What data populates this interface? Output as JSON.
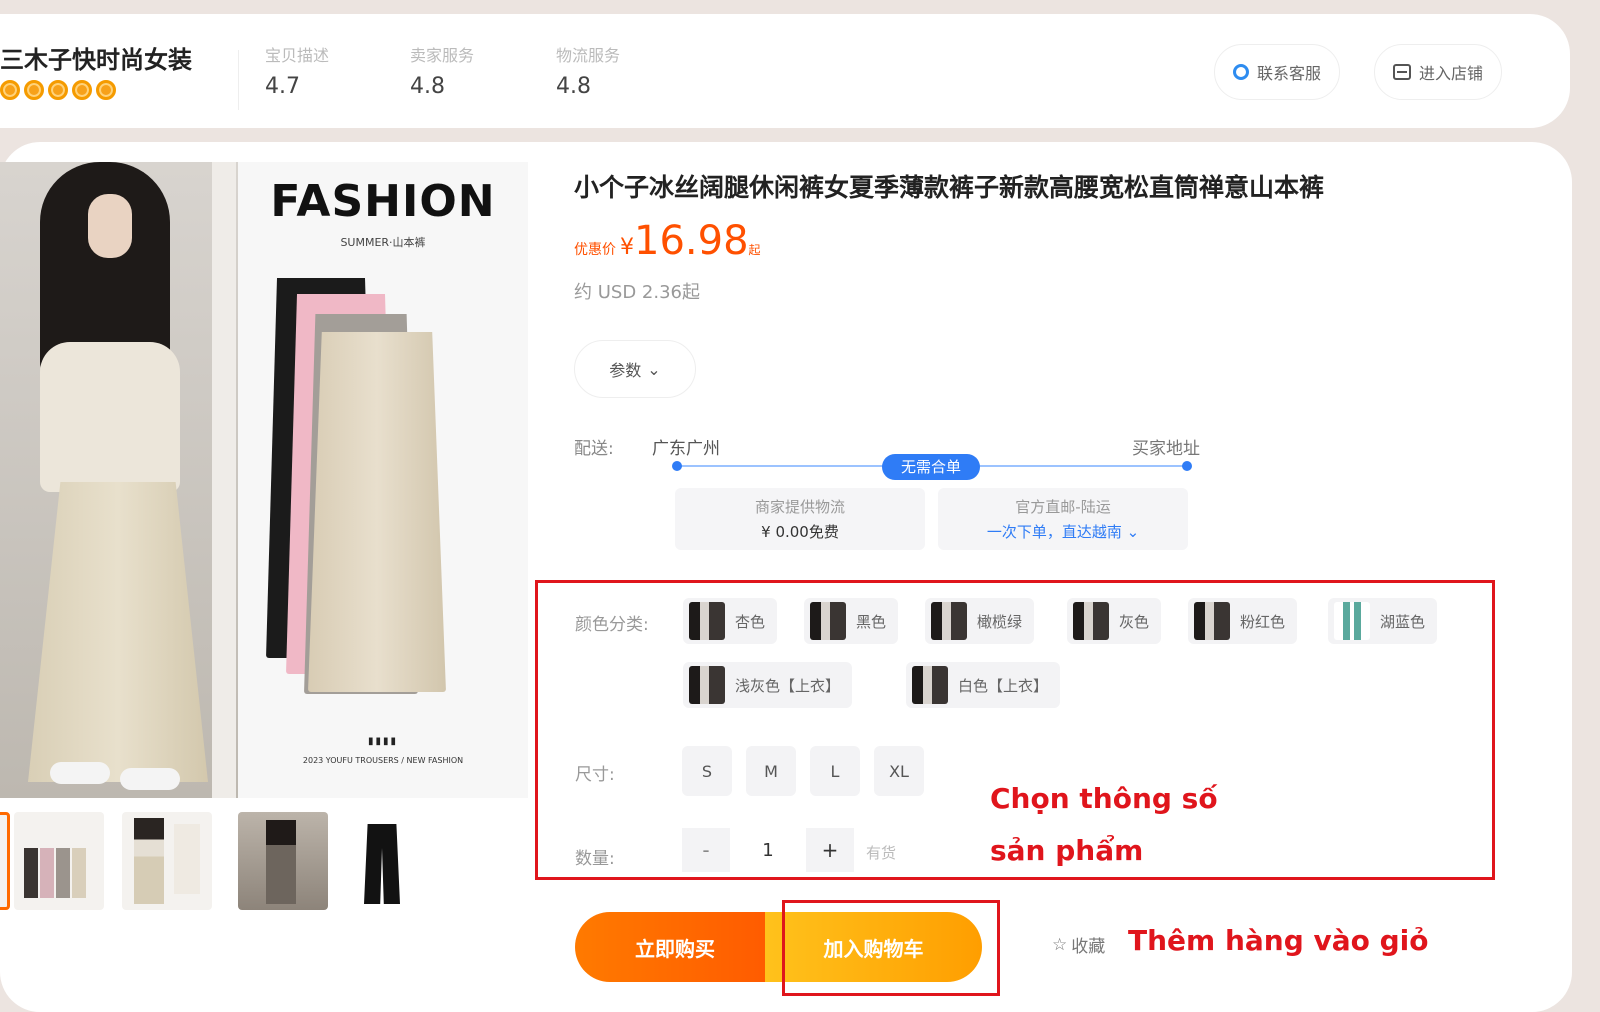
{
  "shop": {
    "name": "三木子快时尚女装",
    "ratings": [
      {
        "label": "宝贝描述",
        "value": "4.7"
      },
      {
        "label": "卖家服务",
        "value": "4.8"
      },
      {
        "label": "物流服务",
        "value": "4.8"
      }
    ],
    "contact_label": "联系客服",
    "enter_store_label": "进入店铺"
  },
  "gallery": {
    "fashion_title": "FASHION",
    "fashion_subtitle": "SUMMER·山本裤",
    "fashion_footer": "2023 YOUFU TROUSERS / NEW FASHION"
  },
  "product": {
    "title": "小个子冰丝阔腿休闲裤女夏季薄款裤子新款高腰宽松直筒禅意山本裤",
    "price_tag": "优惠价",
    "price_currency": "¥",
    "price": "16.98",
    "price_suffix": "起",
    "usd_price": "约 USD 2.36起",
    "params_label": "参数"
  },
  "shipping": {
    "label": "配送:",
    "from": "广东广州",
    "to": "买家地址",
    "badge": "无需合单",
    "box1_line1": "商家提供物流",
    "box1_line2": "¥ 0.00免费",
    "box2_line1": "官方直邮-陆运",
    "box2_line2": "一次下单，直达越南"
  },
  "specs": {
    "color_label": "颜色分类:",
    "colors": [
      "杏色",
      "黑色",
      "橄榄绿",
      "灰色",
      "粉红色",
      "湖蓝色",
      "浅灰色【上衣】",
      "白色【上衣】"
    ],
    "size_label": "尺寸:",
    "sizes": [
      "S",
      "M",
      "L",
      "XL"
    ],
    "qty_label": "数量:",
    "qty_minus": "-",
    "qty_value": "1",
    "qty_plus": "+",
    "stock": "有货"
  },
  "annotations": {
    "specs_line1": "Chọn thông số",
    "specs_line2": "sản phẩm",
    "cart": "Thêm hàng vào giỏ"
  },
  "actions": {
    "buy_now": "立即购买",
    "add_to_cart": "加入购物车",
    "favorite": "收藏"
  },
  "colors": {
    "accent_orange": "#ff5000",
    "annotation_red": "#e0151c",
    "link_blue": "#2f7cf6"
  }
}
